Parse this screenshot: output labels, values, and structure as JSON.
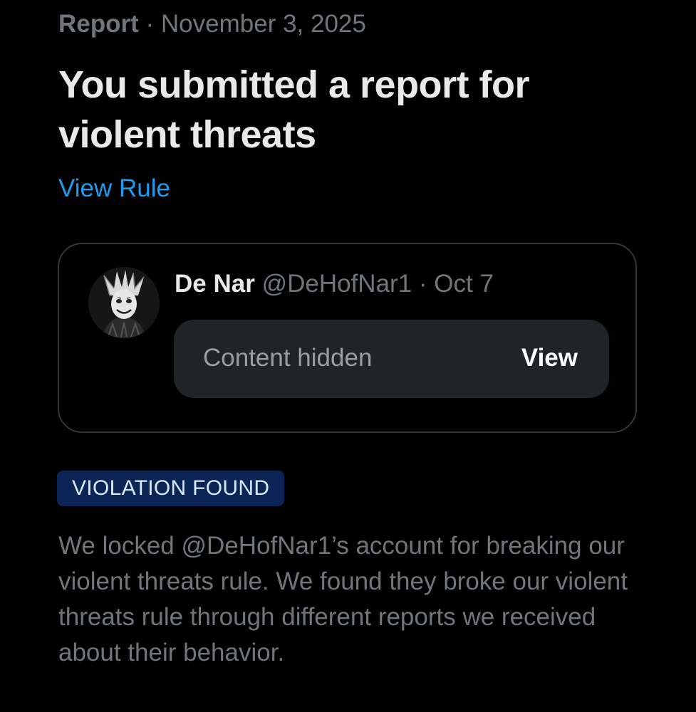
{
  "header": {
    "kind": "Report",
    "separator": "·",
    "date": "November 3, 2025"
  },
  "title": "You submitted a report for violent threats",
  "view_rule_label": "View Rule",
  "post": {
    "avatar_icon": "jester-mask-avatar",
    "display_name": "De Nar",
    "handle": "@DeHofNar1",
    "separator": "·",
    "date": "Oct 7",
    "hidden_label": "Content hidden",
    "view_label": "View"
  },
  "status_badge": "VIOLATION FOUND",
  "outcome_text": "We locked @DeHofNar1’s account for breaking our violent threats rule. We found they broke our violent threats rule through different reports we received about their behavior.",
  "colors": {
    "background": "#000000",
    "link": "#1d9bf0",
    "muted": "#71767b",
    "badge_bg": "#0b2556"
  }
}
